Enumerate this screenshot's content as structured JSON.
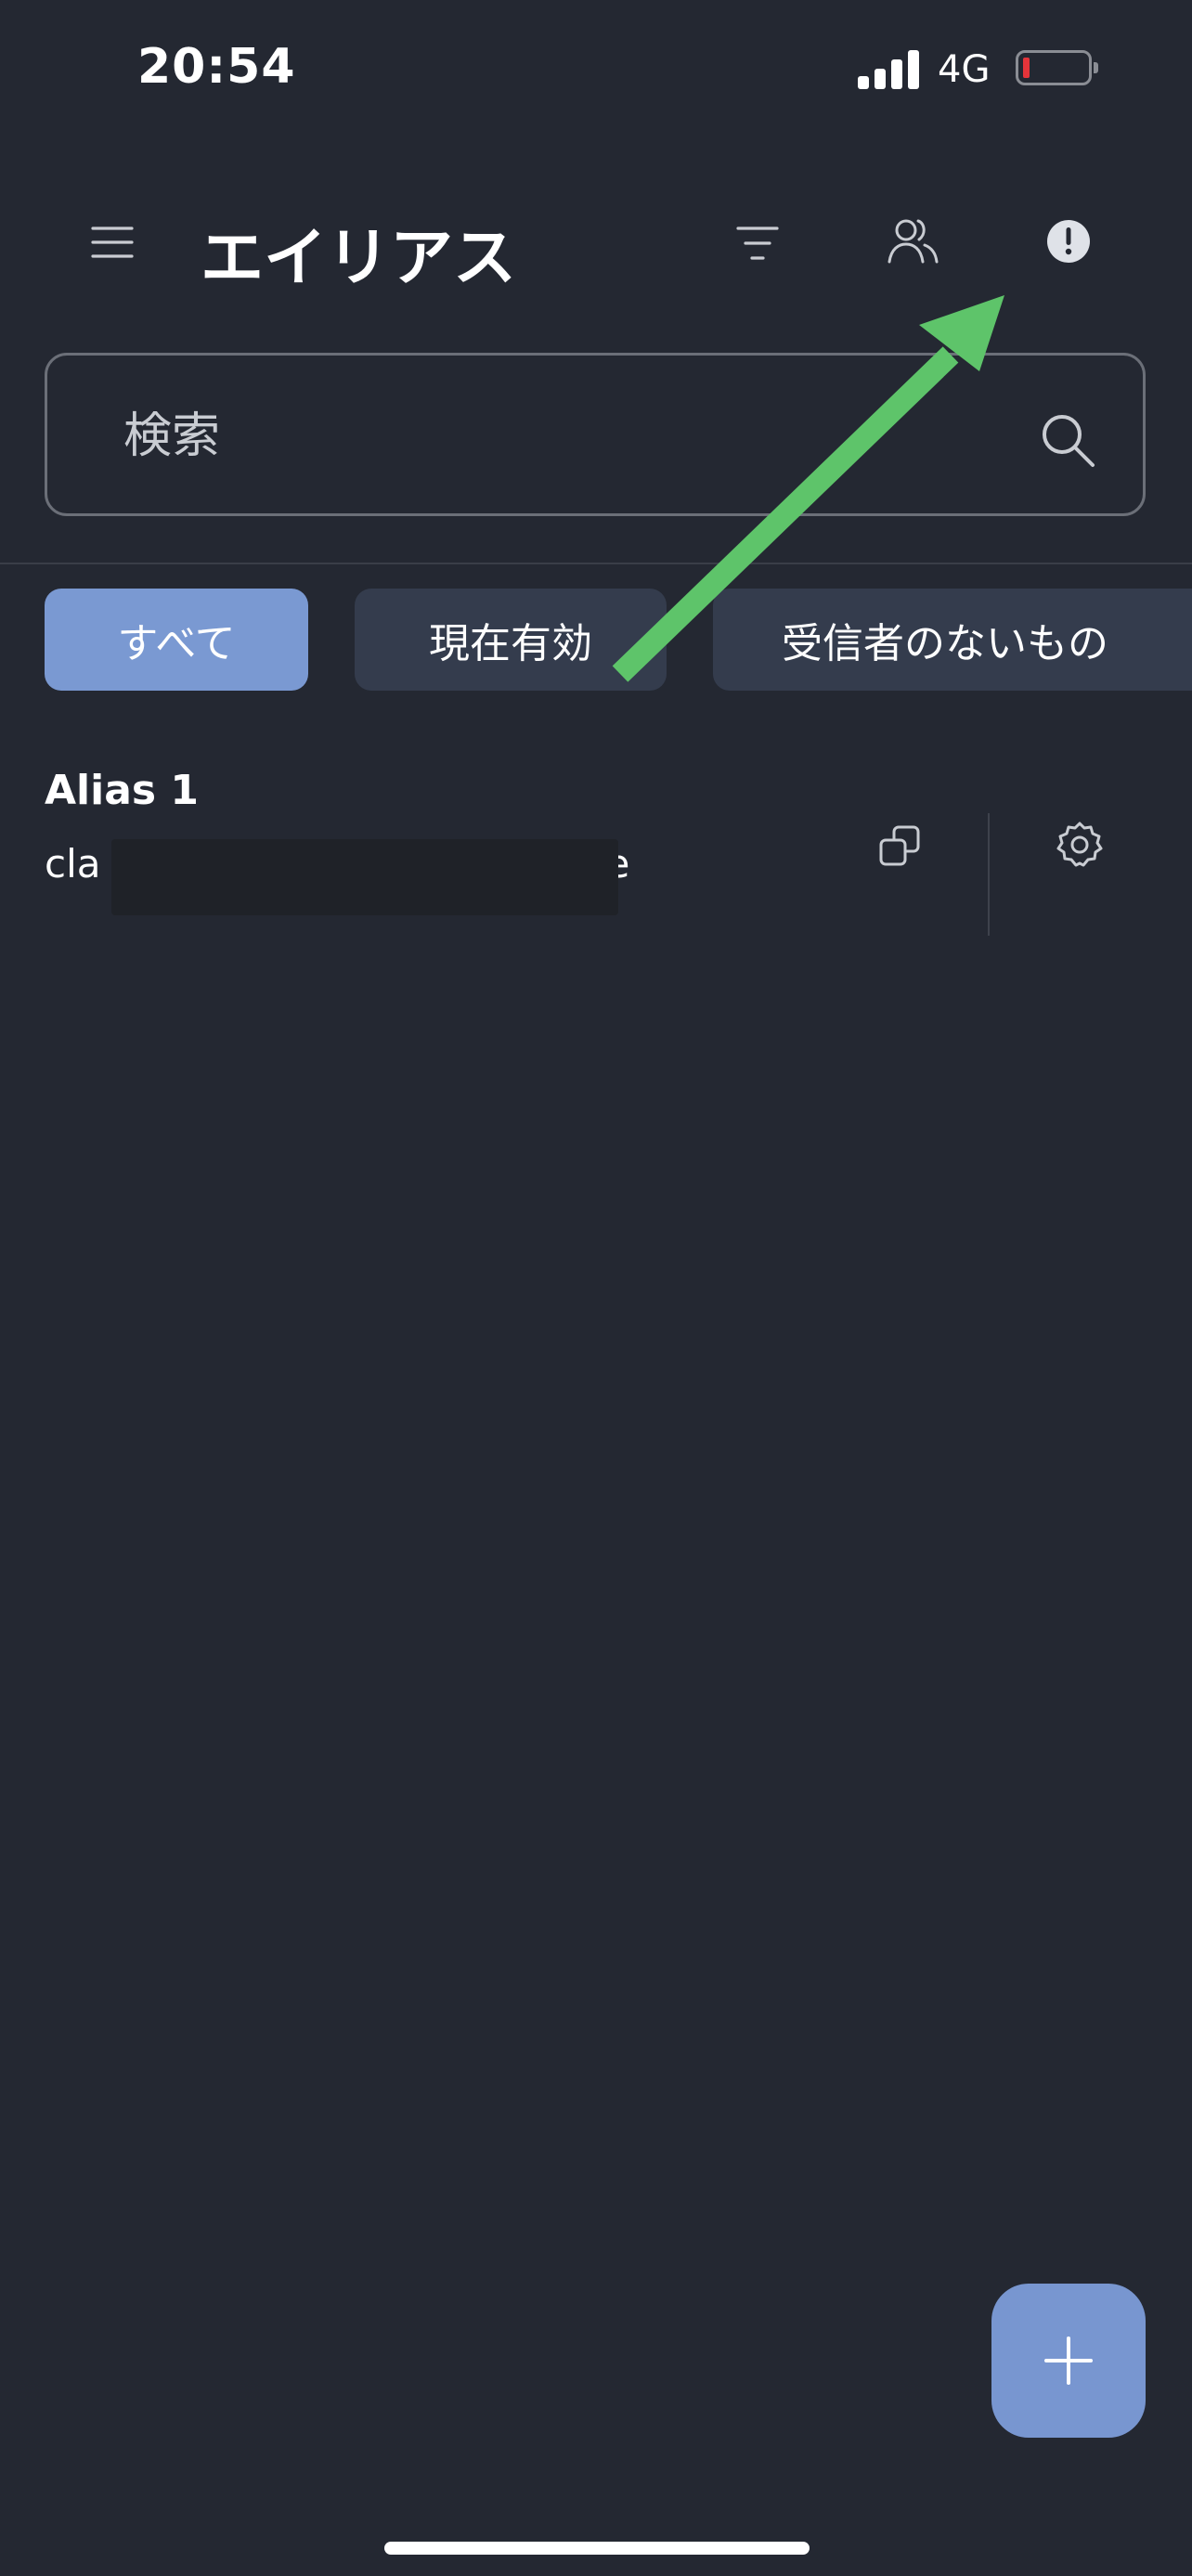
{
  "status_bar": {
    "time": "20:54",
    "network": "4G",
    "battery_level": 0.1,
    "battery_color": "#e5343a"
  },
  "header": {
    "title": "エイリアス",
    "icons": [
      "menu-icon",
      "filter-icon",
      "users-icon",
      "alert-icon"
    ]
  },
  "search": {
    "placeholder": "検索"
  },
  "filters": [
    {
      "label": "すべて",
      "selected": true
    },
    {
      "label": "現在有効",
      "selected": false
    },
    {
      "label": "受信者のないもの",
      "selected": false
    }
  ],
  "aliases": [
    {
      "name": "Alias 1",
      "email_prefix": "cla",
      "email_suffix": "e"
    }
  ],
  "colors": {
    "background": "#242832",
    "accent": "#7a99d2",
    "chip_inactive": "#343c4d",
    "annotation_arrow": "#5ec46a"
  }
}
